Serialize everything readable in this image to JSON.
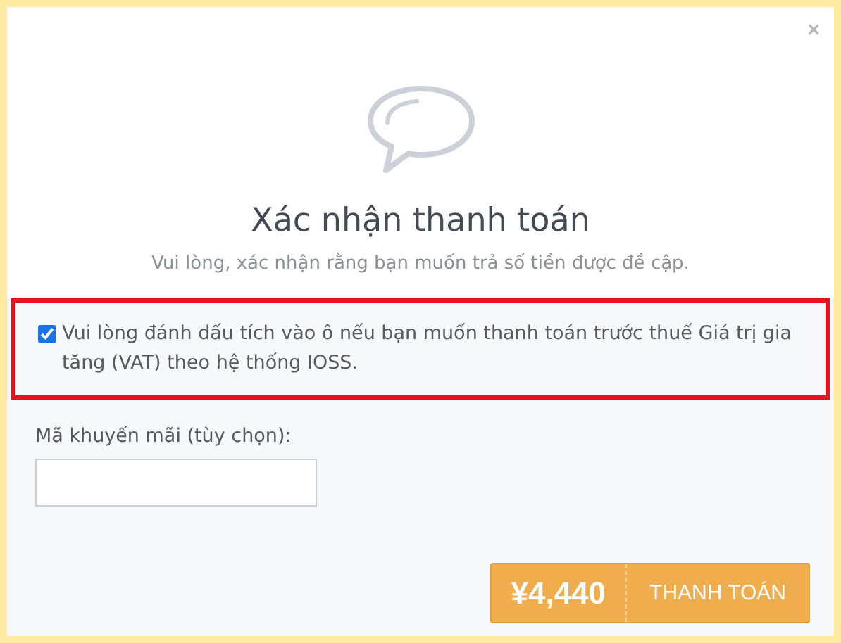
{
  "dialog": {
    "close": "×",
    "title": "Xác nhận thanh toán",
    "subtitle": "Vui lòng, xác nhận rằng bạn muốn trả số tiền được đề cập."
  },
  "vat_option": {
    "checked": true,
    "label": "Vui lòng đánh dấu tích vào ô nếu bạn muốn thanh toán trước thuế Giá trị gia tăng (VAT) theo hệ thống IOSS.",
    "highlighted": true
  },
  "promo": {
    "label": "Mã khuyến mãi (tùy chọn):"
  },
  "pay_button": {
    "amount": "¥4,440",
    "label": "THANH TOÁN"
  }
}
